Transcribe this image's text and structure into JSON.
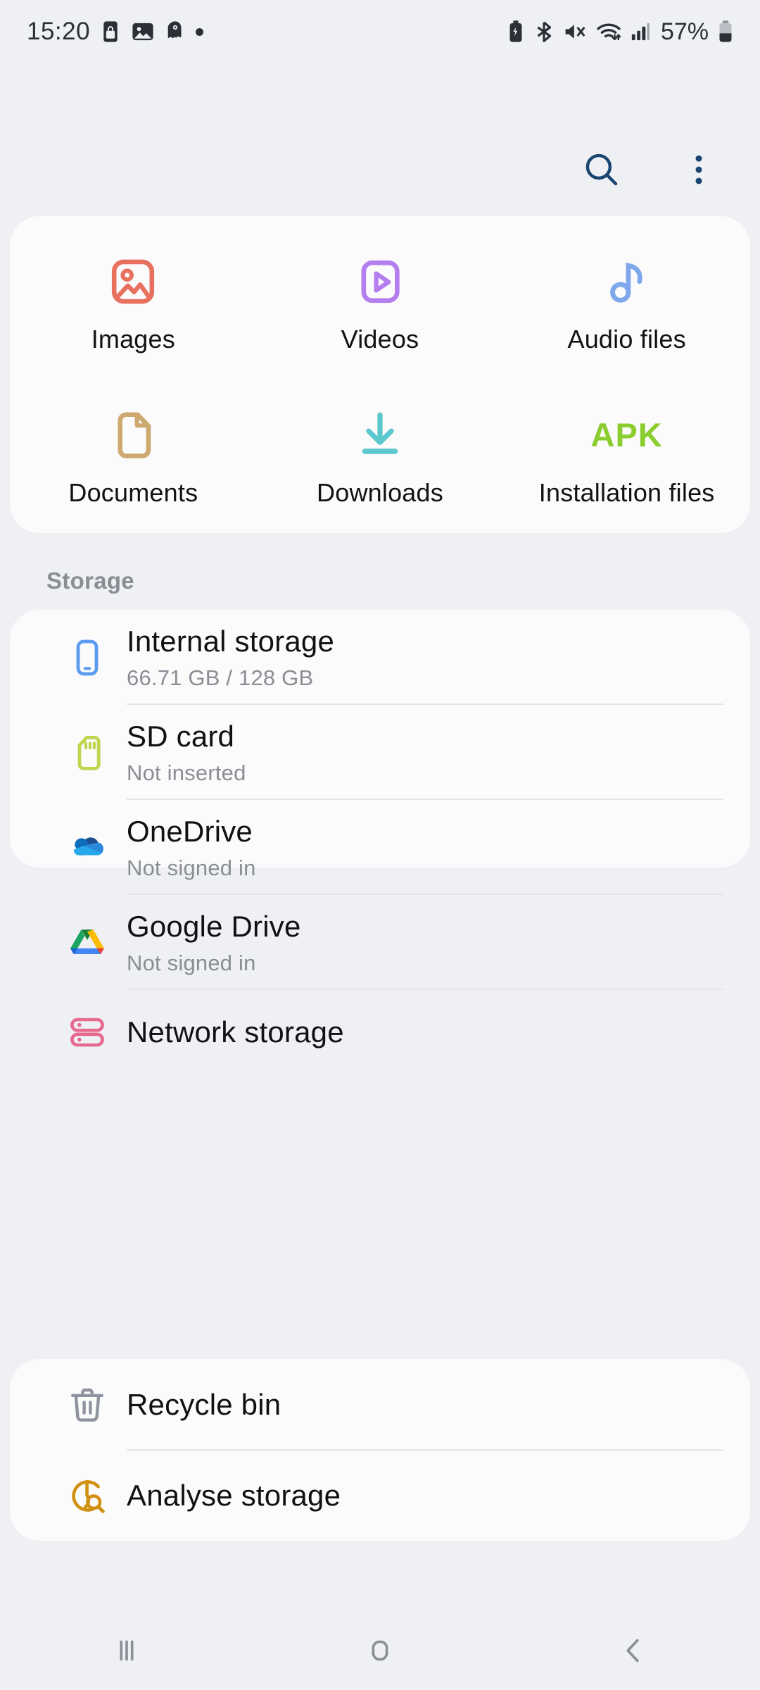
{
  "status_bar": {
    "time": "15:20",
    "battery_percent": "57%",
    "left_icons": [
      "secure-folder-icon",
      "gallery-icon",
      "app-icon",
      "dot-indicator"
    ],
    "right_icons": [
      "battery-saver-icon",
      "bluetooth-icon",
      "mute-icon",
      "wifi-icon",
      "signal-icon",
      "battery-icon"
    ]
  },
  "app_bar": {
    "search_icon": "search-icon",
    "menu_icon": "more-options-icon",
    "accent_color": "#1b4571"
  },
  "categories": [
    {
      "label": "Images",
      "icon": "image-icon",
      "color": "#E8705E"
    },
    {
      "label": "Videos",
      "icon": "video-icon",
      "color": "#B57EEE"
    },
    {
      "label": "Audio files",
      "icon": "music-note-icon",
      "color": "#7FA8EC"
    },
    {
      "label": "Documents",
      "icon": "document-icon",
      "color": "#CDA96F"
    },
    {
      "label": "Downloads",
      "icon": "download-icon",
      "color": "#5BC8CE"
    },
    {
      "label": "Installation files",
      "icon": "apk-icon",
      "color": "#8BCD2E",
      "badge_text": "APK"
    }
  ],
  "storage_section": {
    "header": "Storage",
    "items": [
      {
        "title": "Internal storage",
        "subtitle": "66.71 GB / 128 GB",
        "icon": "phone-icon",
        "color": "#5B9BF0"
      },
      {
        "title": "SD card",
        "subtitle": "Not inserted",
        "icon": "sd-card-icon",
        "color": "#C1D44E"
      },
      {
        "title": "OneDrive",
        "subtitle": "Not signed in",
        "icon": "onedrive-icon",
        "color": "#0A78D4"
      },
      {
        "title": "Google Drive",
        "subtitle": "Not signed in",
        "icon": "google-drive-icon",
        "color": "#0F9D58"
      },
      {
        "title": "Network storage",
        "subtitle": "",
        "icon": "network-storage-icon",
        "color": "#E8698F"
      }
    ]
  },
  "tools_section": {
    "items": [
      {
        "title": "Recycle bin",
        "subtitle": "",
        "icon": "trash-icon",
        "color": "#8E939E"
      },
      {
        "title": "Analyse storage",
        "subtitle": "",
        "icon": "analyse-storage-icon",
        "color": "#D09010"
      }
    ]
  },
  "nav_bar": {
    "recents": "recents-icon",
    "home": "home-icon",
    "back": "back-icon"
  }
}
